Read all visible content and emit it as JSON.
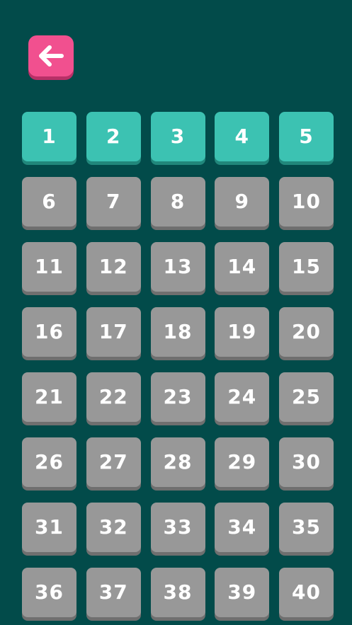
{
  "header": {
    "back_icon": "arrow-left-icon",
    "back_color": "#f1508f"
  },
  "colors": {
    "background": "#024b4a",
    "unlocked": "#3cc2b2",
    "locked": "#989898"
  },
  "levels": [
    {
      "label": "1",
      "status": "unlocked"
    },
    {
      "label": "2",
      "status": "unlocked"
    },
    {
      "label": "3",
      "status": "unlocked"
    },
    {
      "label": "4",
      "status": "unlocked"
    },
    {
      "label": "5",
      "status": "unlocked"
    },
    {
      "label": "6",
      "status": "locked"
    },
    {
      "label": "7",
      "status": "locked"
    },
    {
      "label": "8",
      "status": "locked"
    },
    {
      "label": "9",
      "status": "locked"
    },
    {
      "label": "10",
      "status": "locked"
    },
    {
      "label": "11",
      "status": "locked"
    },
    {
      "label": "12",
      "status": "locked"
    },
    {
      "label": "13",
      "status": "locked"
    },
    {
      "label": "14",
      "status": "locked"
    },
    {
      "label": "15",
      "status": "locked"
    },
    {
      "label": "16",
      "status": "locked"
    },
    {
      "label": "17",
      "status": "locked"
    },
    {
      "label": "18",
      "status": "locked"
    },
    {
      "label": "19",
      "status": "locked"
    },
    {
      "label": "20",
      "status": "locked"
    },
    {
      "label": "21",
      "status": "locked"
    },
    {
      "label": "22",
      "status": "locked"
    },
    {
      "label": "23",
      "status": "locked"
    },
    {
      "label": "24",
      "status": "locked"
    },
    {
      "label": "25",
      "status": "locked"
    },
    {
      "label": "26",
      "status": "locked"
    },
    {
      "label": "27",
      "status": "locked"
    },
    {
      "label": "28",
      "status": "locked"
    },
    {
      "label": "29",
      "status": "locked"
    },
    {
      "label": "30",
      "status": "locked"
    },
    {
      "label": "31",
      "status": "locked"
    },
    {
      "label": "32",
      "status": "locked"
    },
    {
      "label": "33",
      "status": "locked"
    },
    {
      "label": "34",
      "status": "locked"
    },
    {
      "label": "35",
      "status": "locked"
    },
    {
      "label": "36",
      "status": "locked"
    },
    {
      "label": "37",
      "status": "locked"
    },
    {
      "label": "38",
      "status": "locked"
    },
    {
      "label": "39",
      "status": "locked"
    },
    {
      "label": "40",
      "status": "locked"
    }
  ]
}
